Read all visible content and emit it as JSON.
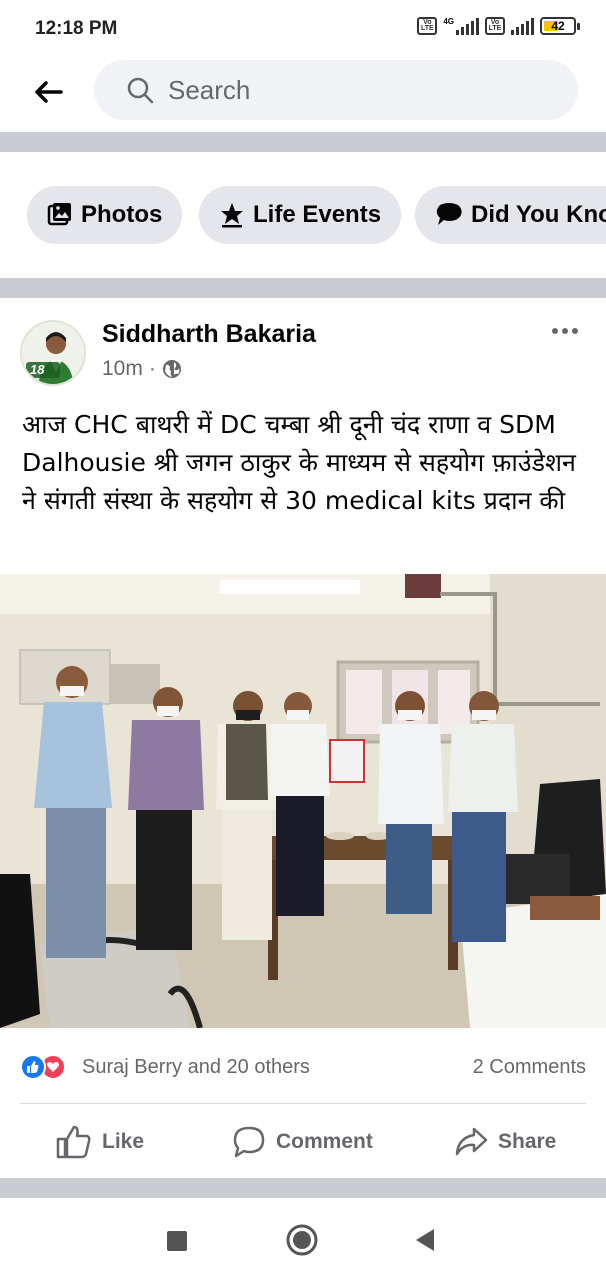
{
  "status": {
    "time": "12:18 PM",
    "network": "4G",
    "volte_label": "Vo LTE",
    "battery": "42"
  },
  "search": {
    "placeholder": "Search"
  },
  "chips": [
    {
      "label": "Photos",
      "icon": "photos-icon"
    },
    {
      "label": "Life Events",
      "icon": "star-icon"
    },
    {
      "label": "Did You Kno",
      "icon": "speech-bubble-icon"
    }
  ],
  "post": {
    "author": "Siddharth Bakaria",
    "time": "10m",
    "separator": "·",
    "privacy_icon": "globe-icon",
    "text": "आज CHC बाथरी में DC चम्बा श्री दूनी चंद राणा व SDM Dalhousie श्री जगन ठाकुर के माध्यम से सहयोग फ़ाउंडेशन ने संगती संस्था के सहयोग से 30 medical kits प्रदान की",
    "avatar_badge": "18",
    "reactions_text": "Suraj Berry and 20 others",
    "comments_text": "2 Comments"
  },
  "actions": {
    "like": "Like",
    "comment": "Comment",
    "share": "Share"
  },
  "colors": {
    "facebook_blue": "#1877f2",
    "love_red": "#f33e58",
    "divider_gray": "#c9ccd1",
    "chip_bg": "#e4e6eb"
  }
}
